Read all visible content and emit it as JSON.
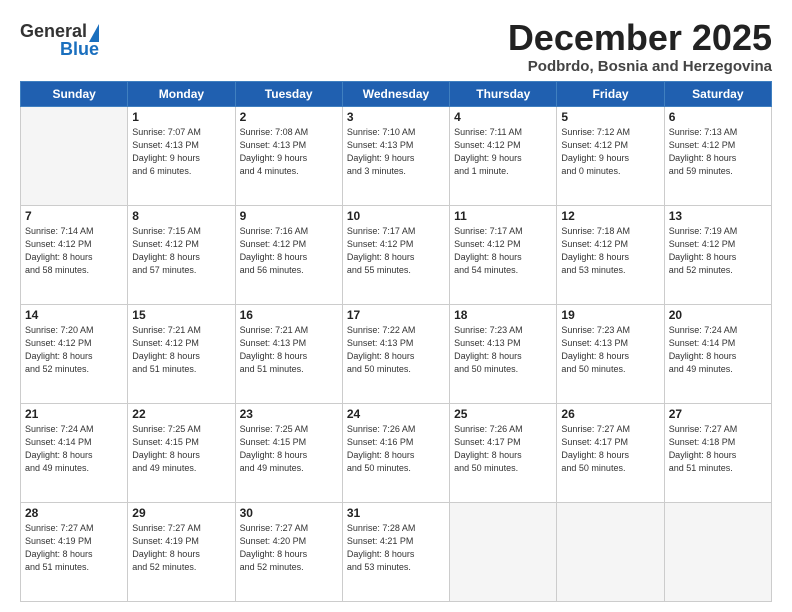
{
  "logo": {
    "general": "General",
    "blue": "Blue"
  },
  "title": "December 2025",
  "subtitle": "Podbrdo, Bosnia and Herzegovina",
  "headers": [
    "Sunday",
    "Monday",
    "Tuesday",
    "Wednesday",
    "Thursday",
    "Friday",
    "Saturday"
  ],
  "weeks": [
    [
      {
        "day": "",
        "info": ""
      },
      {
        "day": "1",
        "info": "Sunrise: 7:07 AM\nSunset: 4:13 PM\nDaylight: 9 hours\nand 6 minutes."
      },
      {
        "day": "2",
        "info": "Sunrise: 7:08 AM\nSunset: 4:13 PM\nDaylight: 9 hours\nand 4 minutes."
      },
      {
        "day": "3",
        "info": "Sunrise: 7:10 AM\nSunset: 4:13 PM\nDaylight: 9 hours\nand 3 minutes."
      },
      {
        "day": "4",
        "info": "Sunrise: 7:11 AM\nSunset: 4:12 PM\nDaylight: 9 hours\nand 1 minute."
      },
      {
        "day": "5",
        "info": "Sunrise: 7:12 AM\nSunset: 4:12 PM\nDaylight: 9 hours\nand 0 minutes."
      },
      {
        "day": "6",
        "info": "Sunrise: 7:13 AM\nSunset: 4:12 PM\nDaylight: 8 hours\nand 59 minutes."
      }
    ],
    [
      {
        "day": "7",
        "info": "Sunrise: 7:14 AM\nSunset: 4:12 PM\nDaylight: 8 hours\nand 58 minutes."
      },
      {
        "day": "8",
        "info": "Sunrise: 7:15 AM\nSunset: 4:12 PM\nDaylight: 8 hours\nand 57 minutes."
      },
      {
        "day": "9",
        "info": "Sunrise: 7:16 AM\nSunset: 4:12 PM\nDaylight: 8 hours\nand 56 minutes."
      },
      {
        "day": "10",
        "info": "Sunrise: 7:17 AM\nSunset: 4:12 PM\nDaylight: 8 hours\nand 55 minutes."
      },
      {
        "day": "11",
        "info": "Sunrise: 7:17 AM\nSunset: 4:12 PM\nDaylight: 8 hours\nand 54 minutes."
      },
      {
        "day": "12",
        "info": "Sunrise: 7:18 AM\nSunset: 4:12 PM\nDaylight: 8 hours\nand 53 minutes."
      },
      {
        "day": "13",
        "info": "Sunrise: 7:19 AM\nSunset: 4:12 PM\nDaylight: 8 hours\nand 52 minutes."
      }
    ],
    [
      {
        "day": "14",
        "info": "Sunrise: 7:20 AM\nSunset: 4:12 PM\nDaylight: 8 hours\nand 52 minutes."
      },
      {
        "day": "15",
        "info": "Sunrise: 7:21 AM\nSunset: 4:12 PM\nDaylight: 8 hours\nand 51 minutes."
      },
      {
        "day": "16",
        "info": "Sunrise: 7:21 AM\nSunset: 4:13 PM\nDaylight: 8 hours\nand 51 minutes."
      },
      {
        "day": "17",
        "info": "Sunrise: 7:22 AM\nSunset: 4:13 PM\nDaylight: 8 hours\nand 50 minutes."
      },
      {
        "day": "18",
        "info": "Sunrise: 7:23 AM\nSunset: 4:13 PM\nDaylight: 8 hours\nand 50 minutes."
      },
      {
        "day": "19",
        "info": "Sunrise: 7:23 AM\nSunset: 4:13 PM\nDaylight: 8 hours\nand 50 minutes."
      },
      {
        "day": "20",
        "info": "Sunrise: 7:24 AM\nSunset: 4:14 PM\nDaylight: 8 hours\nand 49 minutes."
      }
    ],
    [
      {
        "day": "21",
        "info": "Sunrise: 7:24 AM\nSunset: 4:14 PM\nDaylight: 8 hours\nand 49 minutes."
      },
      {
        "day": "22",
        "info": "Sunrise: 7:25 AM\nSunset: 4:15 PM\nDaylight: 8 hours\nand 49 minutes."
      },
      {
        "day": "23",
        "info": "Sunrise: 7:25 AM\nSunset: 4:15 PM\nDaylight: 8 hours\nand 49 minutes."
      },
      {
        "day": "24",
        "info": "Sunrise: 7:26 AM\nSunset: 4:16 PM\nDaylight: 8 hours\nand 50 minutes."
      },
      {
        "day": "25",
        "info": "Sunrise: 7:26 AM\nSunset: 4:17 PM\nDaylight: 8 hours\nand 50 minutes."
      },
      {
        "day": "26",
        "info": "Sunrise: 7:27 AM\nSunset: 4:17 PM\nDaylight: 8 hours\nand 50 minutes."
      },
      {
        "day": "27",
        "info": "Sunrise: 7:27 AM\nSunset: 4:18 PM\nDaylight: 8 hours\nand 51 minutes."
      }
    ],
    [
      {
        "day": "28",
        "info": "Sunrise: 7:27 AM\nSunset: 4:19 PM\nDaylight: 8 hours\nand 51 minutes."
      },
      {
        "day": "29",
        "info": "Sunrise: 7:27 AM\nSunset: 4:19 PM\nDaylight: 8 hours\nand 52 minutes."
      },
      {
        "day": "30",
        "info": "Sunrise: 7:27 AM\nSunset: 4:20 PM\nDaylight: 8 hours\nand 52 minutes."
      },
      {
        "day": "31",
        "info": "Sunrise: 7:28 AM\nSunset: 4:21 PM\nDaylight: 8 hours\nand 53 minutes."
      },
      {
        "day": "",
        "info": ""
      },
      {
        "day": "",
        "info": ""
      },
      {
        "day": "",
        "info": ""
      }
    ]
  ]
}
